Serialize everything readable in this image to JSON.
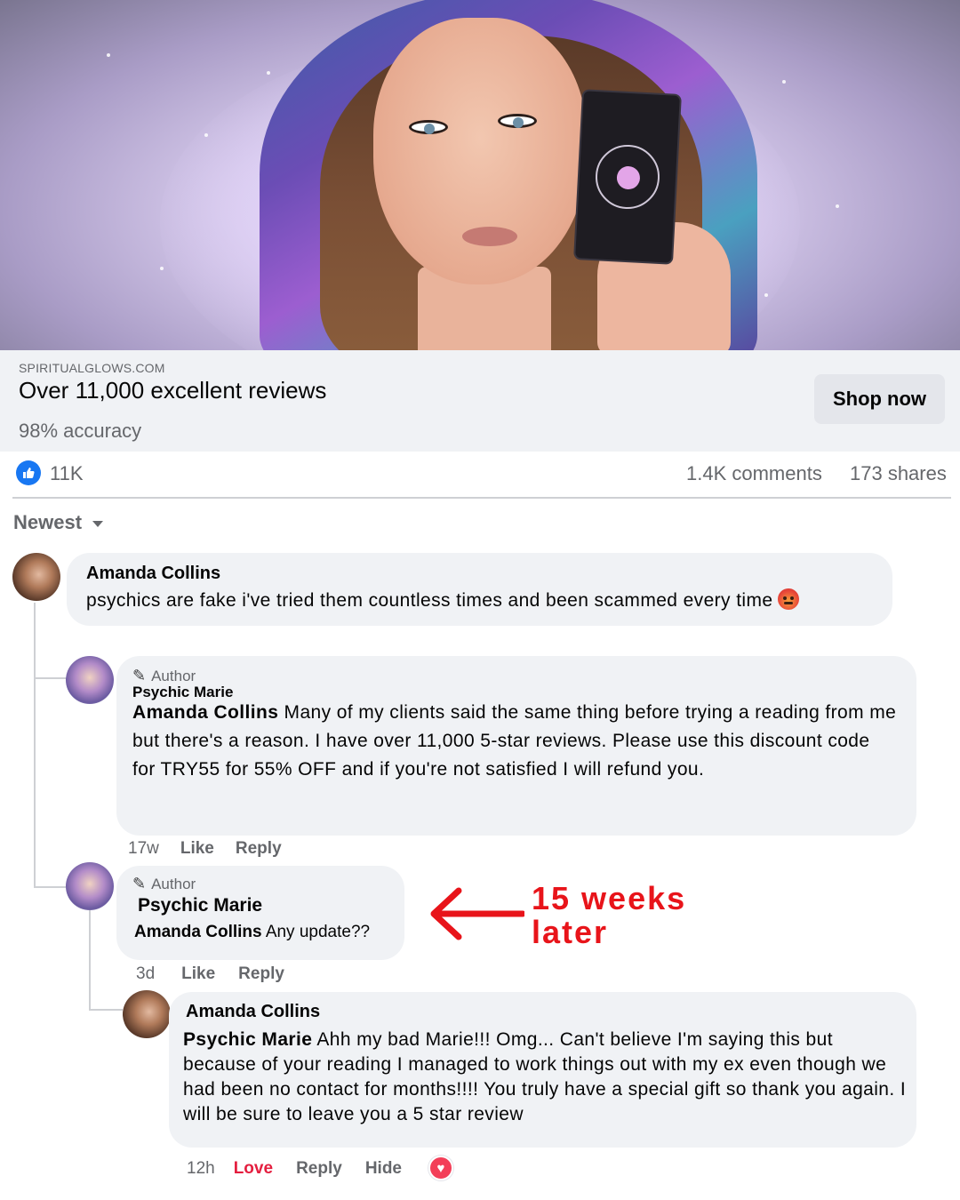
{
  "ad": {
    "domain": "SPIRITUALGLOWS.COM",
    "headline": "Over 11,000 excellent reviews",
    "subline": "98% accuracy",
    "cta_label": "Shop now"
  },
  "stats": {
    "likes": "11K",
    "comments": "1.4K comments",
    "shares": "173 shares"
  },
  "sort": {
    "label": "Newest"
  },
  "comments": [
    {
      "author": "Amanda Collins",
      "text": "psychics are fake i've tried them countless times and been scammed every time",
      "emoji": "angry-face-icon"
    },
    {
      "author_tag": "Author",
      "author": "Psychic Marie",
      "mention": "Amanda Collins",
      "text": "Many of my clients said the same thing before trying a reading from me but there's a reason. I have over 11,000 5-star reviews. Please use this discount code for TRY55 for 55% OFF and if you're not satisfied I will refund you.",
      "time": "17w",
      "like_label": "Like",
      "reply_label": "Reply"
    },
    {
      "author_tag": "Author",
      "author": "Psychic Marie",
      "mention": "Amanda Collins",
      "text": "Any update??",
      "time": "3d",
      "like_label": "Like",
      "reply_label": "Reply"
    },
    {
      "author": "Amanda Collins",
      "mention": "Psychic Marie",
      "text": "Ahh my bad Marie!!! Omg... Can't believe I'm saying this but because of your reading I managed to work things out with my ex even though we had been no contact for months!!!! You truly have a special gift so thank you again. I will be sure to leave you a 5 star review",
      "time": "12h",
      "love_label": "Love",
      "reply_label": "Reply",
      "hide_label": "Hide",
      "reaction": "heart-icon"
    }
  ],
  "annotation": {
    "line1": "15 weeks",
    "line2": "later"
  },
  "colors": {
    "link_bg": "#f0f2f5",
    "like_blue": "#1877f2",
    "love_red": "#e41e3f",
    "annotation_red": "#e8141a"
  }
}
